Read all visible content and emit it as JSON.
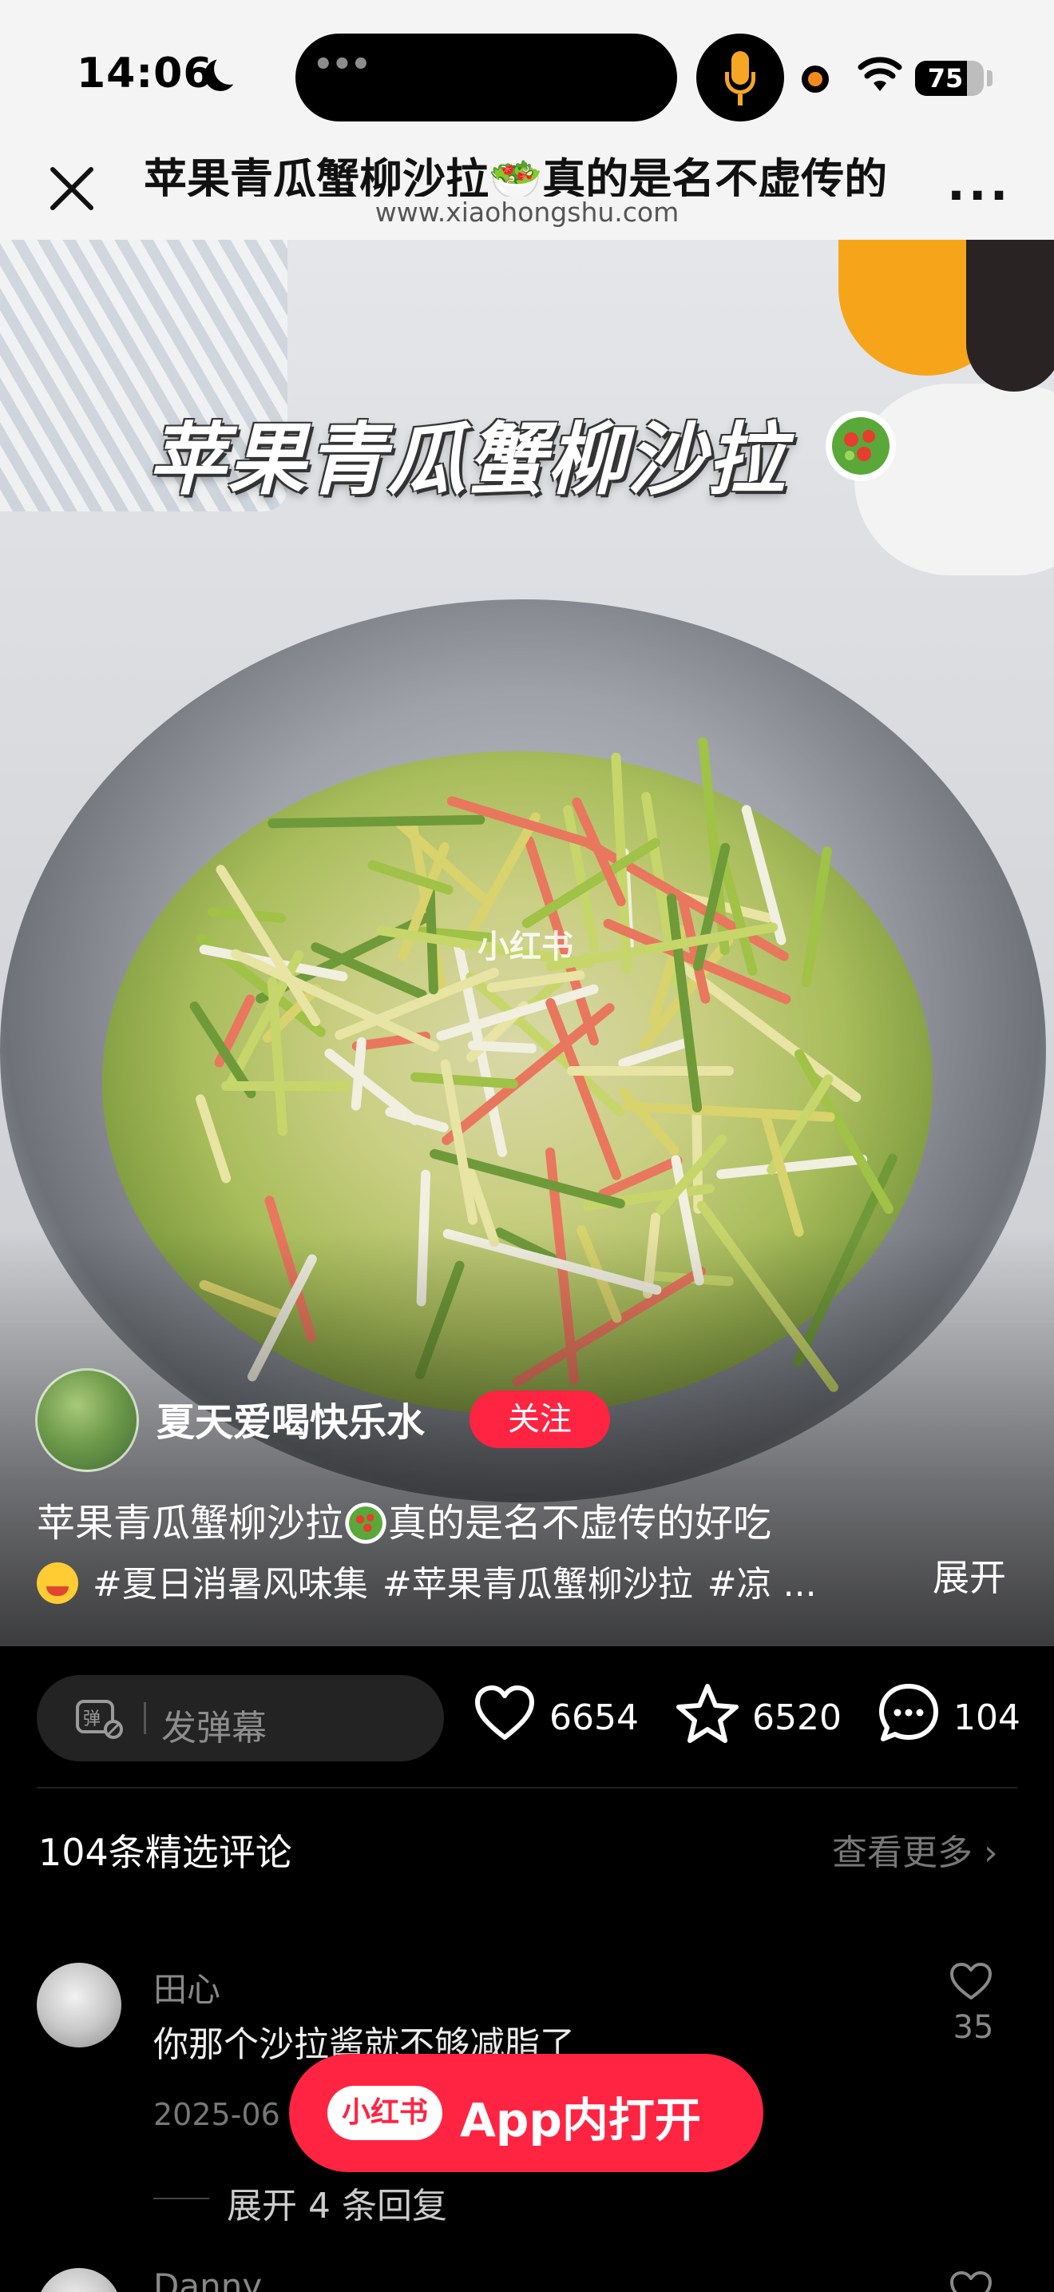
{
  "status_bar": {
    "time": "14:06",
    "battery_level": "75",
    "battery_fraction": 0.75
  },
  "browser": {
    "title": "苹果青瓜蟹柳沙拉🥗真的是名不虚传的",
    "url": "www.xiaohongshu.com",
    "more_label": "..."
  },
  "post": {
    "image_title": "苹果青瓜蟹柳沙拉",
    "watermark": "小红书",
    "author": "夏天爱喝快乐水",
    "follow_label": "关注",
    "caption": "苹果青瓜蟹柳沙拉",
    "caption_suffix": "真的是名不虚传的好吃",
    "tags": [
      "#夏日消暑风味集",
      "#苹果青瓜蟹柳沙拉",
      "#凉 ..."
    ],
    "expand_label": "展开"
  },
  "actions": {
    "danmu_placeholder": "发弹幕",
    "likes": "6654",
    "favorites": "6520",
    "comments": "104"
  },
  "comments": {
    "header": "104条精选评论",
    "see_more": "查看更多 ›",
    "items": [
      {
        "name": "田心",
        "text": "你那个沙拉酱就不够减脂了",
        "date": "2025-06",
        "likes": "35",
        "replies_label": "展开 4 条回复"
      },
      {
        "name": "Danny"
      }
    ]
  },
  "open_app": {
    "logo": "小红书",
    "label": "App内打开"
  },
  "colors": {
    "brand_red": "#ff2442",
    "background": "#000000",
    "header_bg": "#f4f4f4"
  }
}
